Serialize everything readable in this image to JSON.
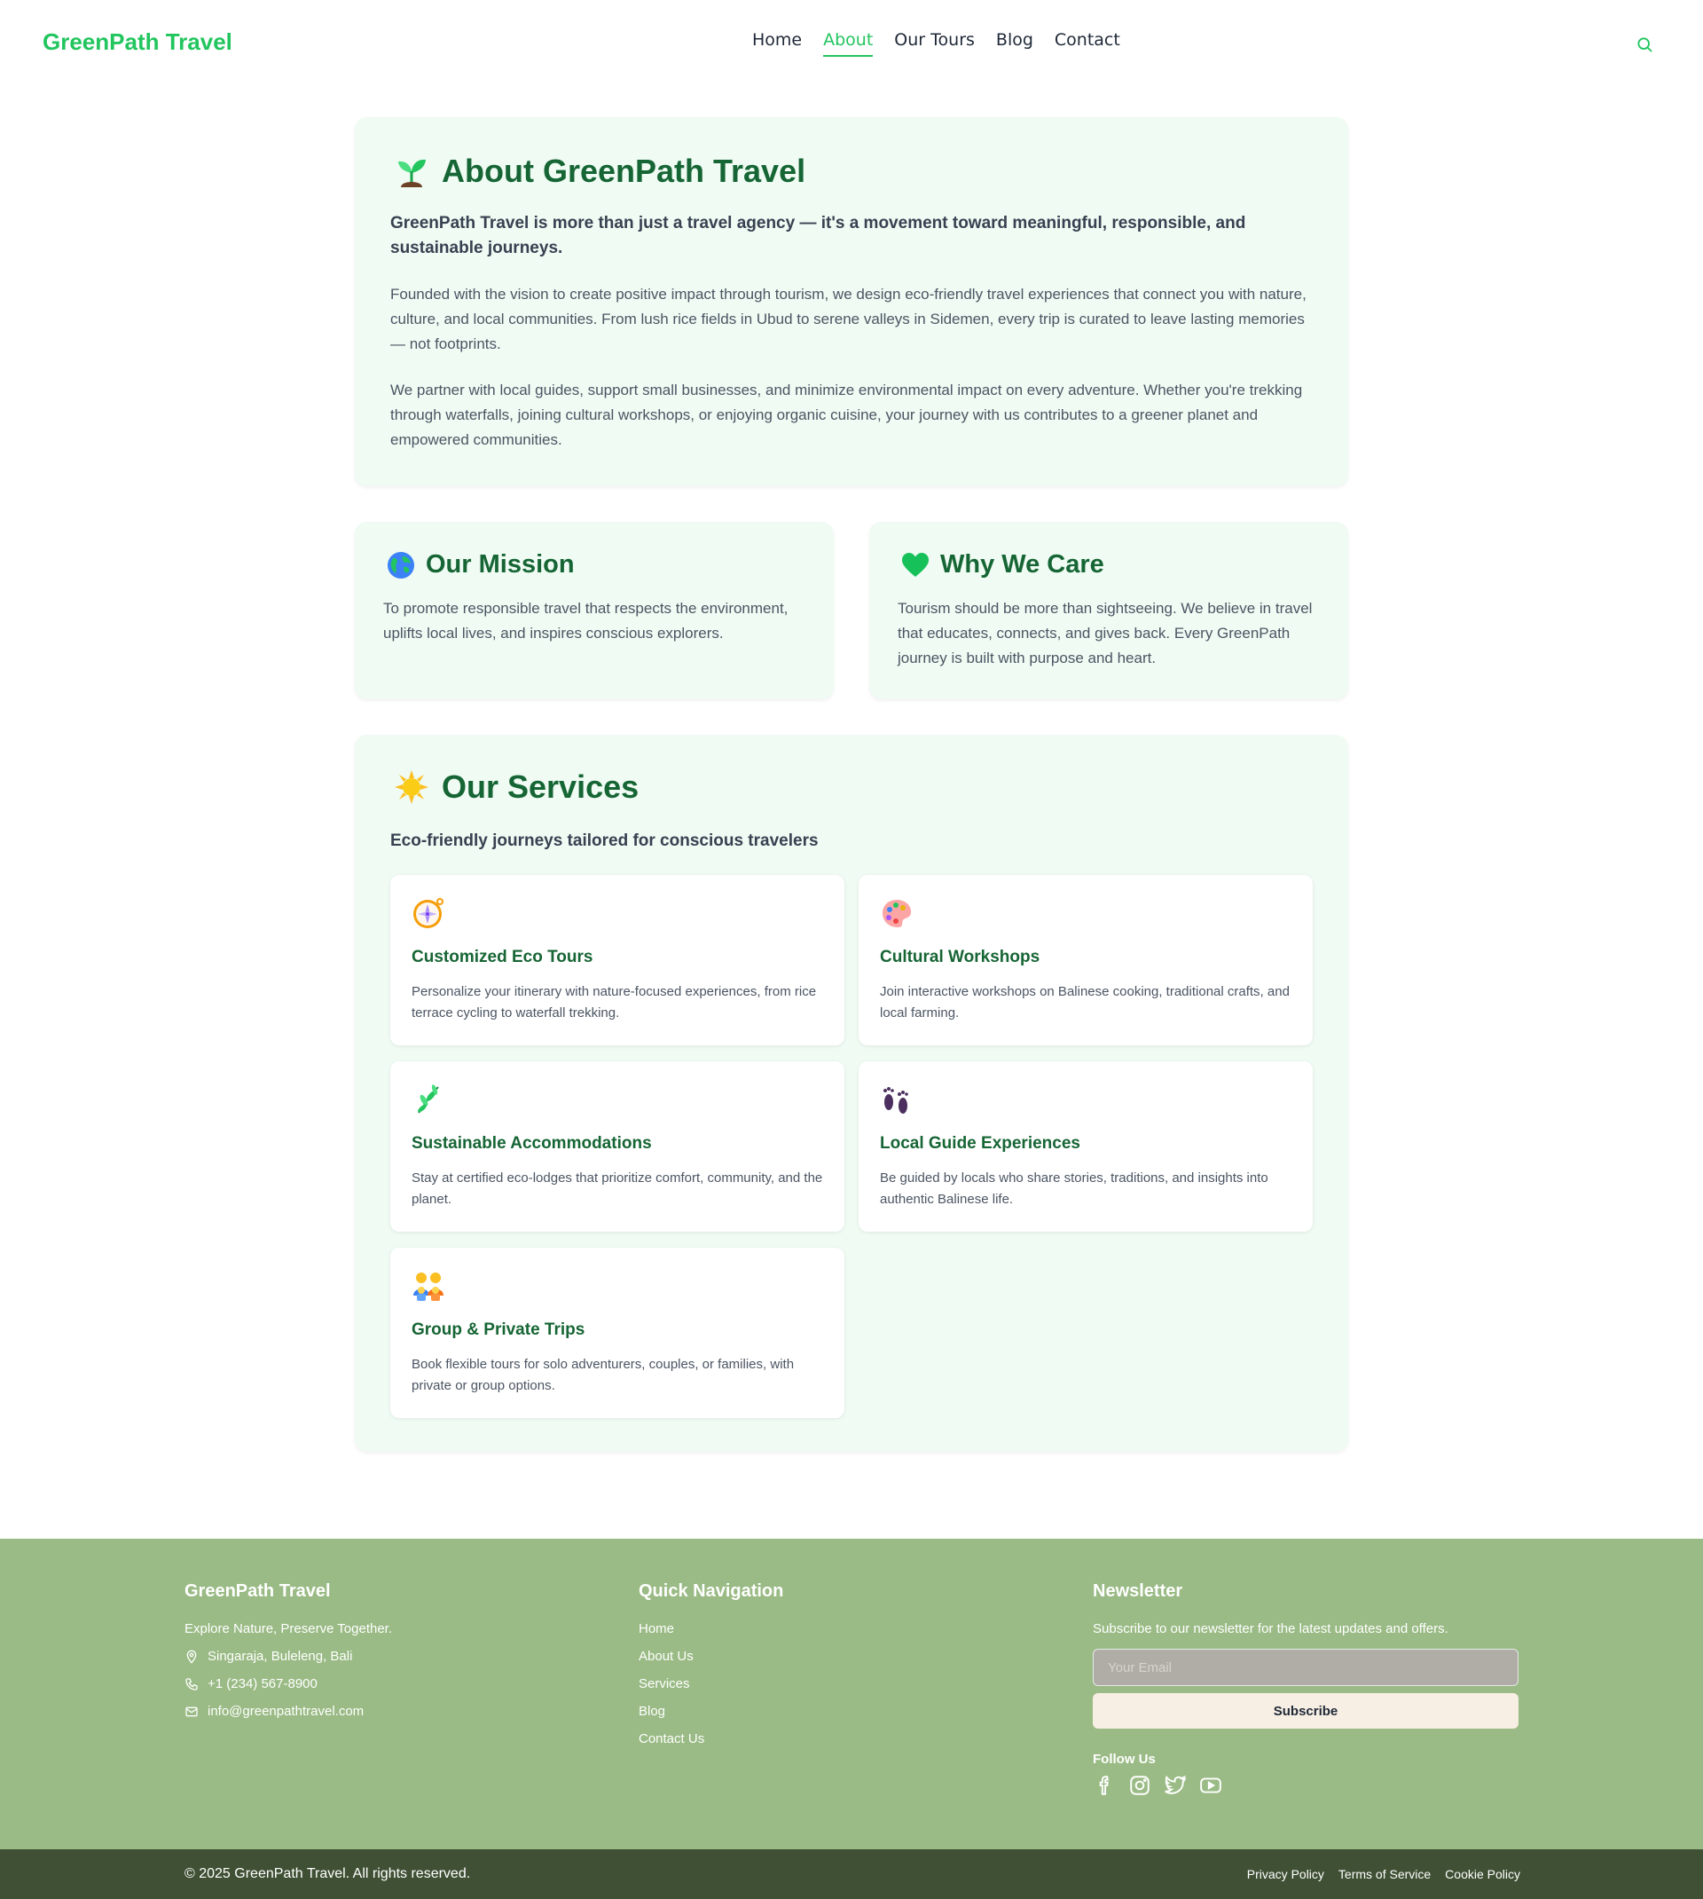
{
  "header": {
    "logo": "GreenPath Travel",
    "nav": [
      "Home",
      "About",
      "Our Tours",
      "Blog",
      "Contact"
    ],
    "active_nav": "About"
  },
  "about": {
    "title": "About GreenPath Travel",
    "lead": "GreenPath Travel is more than just a travel agency — it's a movement toward meaningful, responsible, and sustainable journeys.",
    "p1": "Founded with the vision to create positive impact through tourism, we design eco-friendly travel experiences that connect you with nature, culture, and local communities. From lush rice fields in Ubud to serene valleys in Sidemen, every trip is curated to leave lasting memories — not footprints.",
    "p2": "We partner with local guides, support small businesses, and minimize environmental impact on every adventure. Whether you're trekking through waterfalls, joining cultural workshops, or enjoying organic cuisine, your journey with us contributes to a greener planet and empowered communities."
  },
  "mission": {
    "title": "Our Mission",
    "text": "To promote responsible travel that respects the environment, uplifts local lives, and inspires conscious explorers."
  },
  "care": {
    "title": "Why We Care",
    "text": "Tourism should be more than sightseeing. We believe in travel that educates, connects, and gives back. Every GreenPath journey is built with purpose and heart."
  },
  "services": {
    "title": "Our Services",
    "subtitle": "Eco-friendly journeys tailored for conscious travelers",
    "items": [
      {
        "icon": "compass-icon",
        "title": "Customized Eco Tours",
        "desc": "Personalize your itinerary with nature-focused experiences, from rice terrace cycling to waterfall trekking."
      },
      {
        "icon": "palette-icon",
        "title": "Cultural Workshops",
        "desc": "Join interactive workshops on Balinese cooking, traditional crafts, and local farming."
      },
      {
        "icon": "herb-icon",
        "title": "Sustainable Accommodations",
        "desc": "Stay at certified eco-lodges that prioritize comfort, community, and the planet."
      },
      {
        "icon": "footprints-icon",
        "title": "Local Guide Experiences",
        "desc": "Be guided by locals who share stories, traditions, and insights into authentic Balinese life."
      },
      {
        "icon": "family-icon",
        "title": "Group & Private Trips",
        "desc": "Book flexible tours for solo adventurers, couples, or families, with private or group options."
      }
    ]
  },
  "footer": {
    "brand": {
      "title": "GreenPath Travel",
      "tagline": "Explore Nature, Preserve Together.",
      "address": "Singaraja, Buleleng, Bali",
      "phone": "+1 (234) 567-8900",
      "email": "info@greenpathtravel.com"
    },
    "nav": {
      "title": "Quick Navigation",
      "links": [
        "Home",
        "About Us",
        "Services",
        "Blog",
        "Contact Us"
      ]
    },
    "newsletter": {
      "title": "Newsletter",
      "text": "Subscribe to our newsletter for the latest updates and offers.",
      "placeholder": "Your Email",
      "button": "Subscribe",
      "follow": "Follow Us"
    },
    "copyright": "© 2025 GreenPath Travel. All rights reserved.",
    "legal": [
      "Privacy Policy",
      "Terms of Service",
      "Cookie Policy"
    ]
  },
  "colors": {
    "brand_green": "#22c55e",
    "heading_green": "#166534",
    "card_bg": "#effbf3",
    "footer_bg": "#9abb85",
    "bottom_bar": "#3f5034"
  }
}
